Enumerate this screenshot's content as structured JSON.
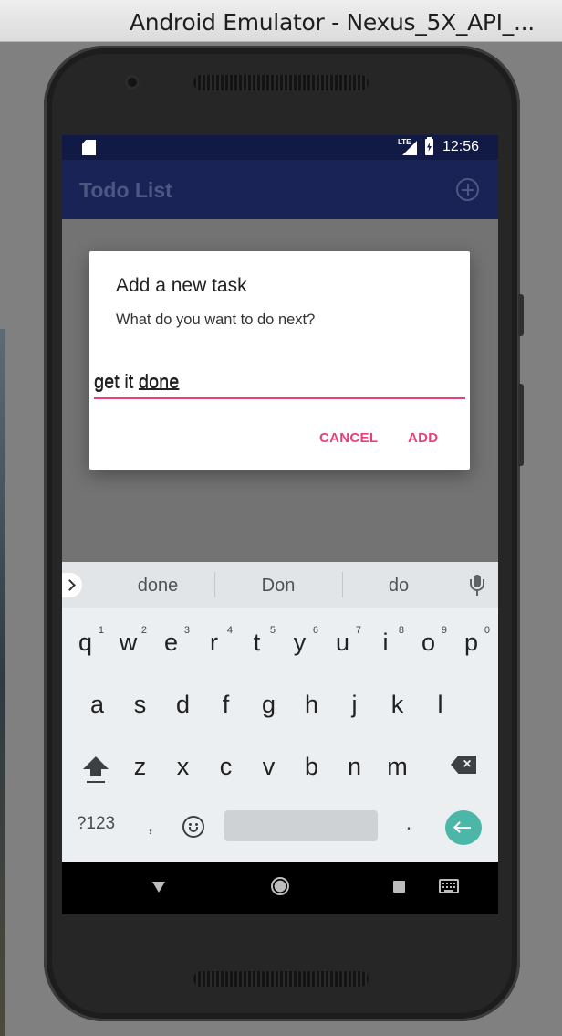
{
  "window": {
    "title": "Android Emulator - Nexus_5X_API_..."
  },
  "status_bar": {
    "network": "LTE",
    "time": "12:56",
    "icons": [
      "sd-card-icon",
      "signal-icon",
      "battery-charging-icon"
    ]
  },
  "app_bar": {
    "title": "Todo List",
    "action_icon": "add-circle-icon"
  },
  "dialog": {
    "title": "Add a new task",
    "message": "What do you want to do next?",
    "input": {
      "value": "get it done",
      "typed_prefix": "get it ",
      "composing": "done"
    },
    "buttons": {
      "cancel": "CANCEL",
      "confirm": "ADD"
    }
  },
  "keyboard": {
    "suggestions": [
      "done",
      "Don",
      "do"
    ],
    "row1": [
      {
        "c": "q",
        "h": "1"
      },
      {
        "c": "w",
        "h": "2"
      },
      {
        "c": "e",
        "h": "3"
      },
      {
        "c": "r",
        "h": "4"
      },
      {
        "c": "t",
        "h": "5"
      },
      {
        "c": "y",
        "h": "6"
      },
      {
        "c": "u",
        "h": "7"
      },
      {
        "c": "i",
        "h": "8"
      },
      {
        "c": "o",
        "h": "9"
      },
      {
        "c": "p",
        "h": "0"
      }
    ],
    "row2": [
      "a",
      "s",
      "d",
      "f",
      "g",
      "h",
      "j",
      "k",
      "l"
    ],
    "row3": [
      "z",
      "x",
      "c",
      "v",
      "b",
      "n",
      "m"
    ],
    "symbols_key": "?123",
    "comma_key": ",",
    "period_key": ".",
    "colors": {
      "enter": "#4cb6a8",
      "accent": "#e9407a",
      "app_bar": "#1a2356"
    }
  },
  "nav_bar": {
    "icons": [
      "back-icon",
      "home-icon",
      "recents-icon",
      "keyboard-switch-icon"
    ]
  }
}
